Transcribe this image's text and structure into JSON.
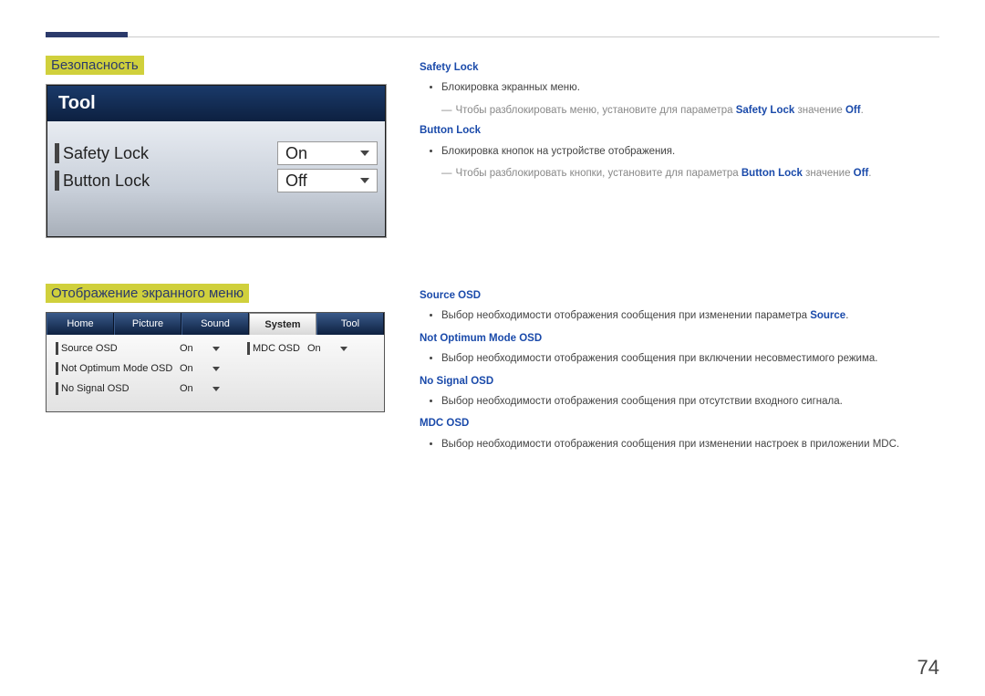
{
  "section1": {
    "title": "Безопасность",
    "panel_header": "Tool",
    "rows": [
      {
        "label": "Safety Lock",
        "value": "On"
      },
      {
        "label": "Button Lock",
        "value": "Off"
      }
    ]
  },
  "desc1": {
    "safety_lock_title": "Safety Lock",
    "safety_lock_item": "Блокировка экранных меню.",
    "safety_lock_sub_pre": "Чтобы разблокировать меню, установите для параметра ",
    "safety_lock_sub_b1": "Safety Lock",
    "safety_lock_sub_mid": " значение ",
    "safety_lock_sub_b2": "Off",
    "safety_lock_sub_post": ".",
    "button_lock_title": "Button Lock",
    "button_lock_item": "Блокировка кнопок на устройстве отображения.",
    "button_lock_sub_pre": "Чтобы разблокировать кнопки, установите для параметра ",
    "button_lock_sub_b1": "Button Lock",
    "button_lock_sub_mid": " значение ",
    "button_lock_sub_b2": "Off",
    "button_lock_sub_post": "."
  },
  "section2": {
    "title": "Отображение экранного меню",
    "tabs": [
      "Home",
      "Picture",
      "Sound",
      "System",
      "Tool"
    ],
    "active_tab": "System",
    "col1": [
      {
        "label": "Source OSD",
        "value": "On"
      },
      {
        "label": "Not Optimum Mode OSD",
        "value": "On"
      },
      {
        "label": "No Signal OSD",
        "value": "On"
      }
    ],
    "col2": [
      {
        "label": "MDC OSD",
        "value": "On"
      }
    ]
  },
  "desc2": {
    "source_title": "Source OSD",
    "source_item_pre": "Выбор необходимости отображения сообщения при изменении параметра ",
    "source_item_b": "Source",
    "source_item_post": ".",
    "notopt_title": "Not Optimum Mode OSD",
    "notopt_item": "Выбор необходимости отображения сообщения при включении несовместимого режима.",
    "nosignal_title": "No Signal OSD",
    "nosignal_item": "Выбор необходимости отображения сообщения при отсутствии входного сигнала.",
    "mdc_title": "MDC OSD",
    "mdc_item": "Выбор необходимости отображения сообщения при изменении настроек в приложении MDC."
  },
  "page_number": "74"
}
